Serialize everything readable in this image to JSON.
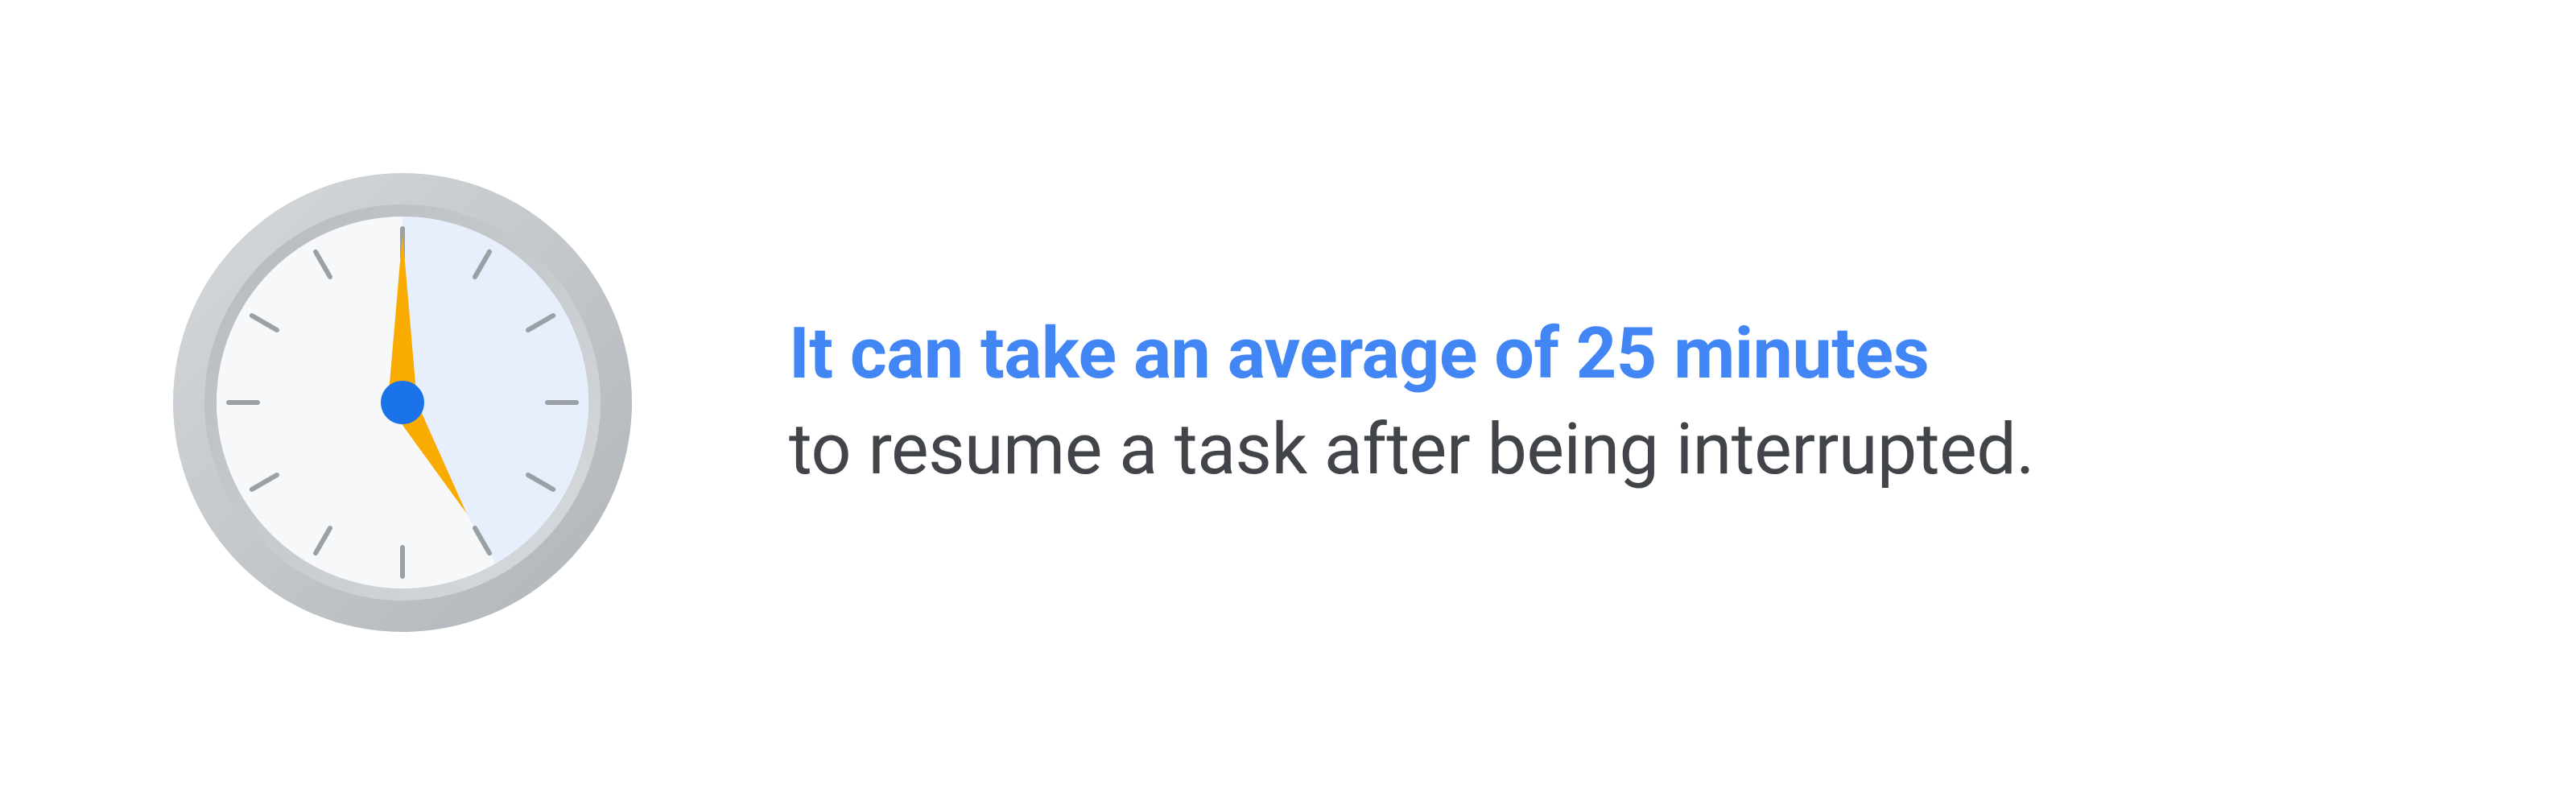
{
  "text": {
    "headline": "It can take an average of 25 minutes",
    "subline": "to resume a task after being interrupted."
  },
  "colors": {
    "accent": "#4285f4",
    "body": "#414549",
    "clock_rim_light": "#cfd3d7",
    "clock_rim_dark": "#b8bcc0",
    "clock_face": "#f6f8fa",
    "clock_shade": "#e7eefc",
    "tick": "#9aa0a6",
    "hand": "#f9ab00",
    "center": "#1a73e8"
  },
  "clock": {
    "minute_hand_angle": 0,
    "hour_hand_angle": 150,
    "shade_start_angle": 0,
    "shade_end_angle": 150
  }
}
